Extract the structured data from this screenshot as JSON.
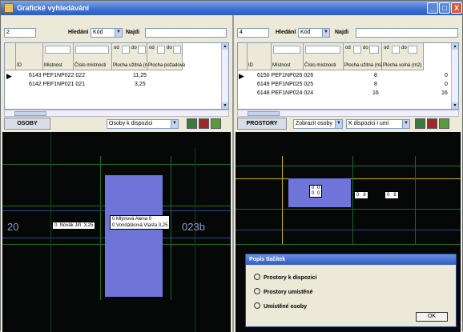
{
  "window": {
    "title": "Grafické vyhledávání",
    "min": "_",
    "max": "□",
    "close": "X"
  },
  "left": {
    "count": "2",
    "search_label": "Hledání",
    "search_by": "Kód",
    "find_label": "Najdi",
    "headers": {
      "id": "ID",
      "room": "Místnost",
      "room_no": "Číslo místnosti",
      "area_used": "Plocha užitná (m2)",
      "area_required": "Plocha požadová",
      "od": "od",
      "do": "do"
    },
    "rows": [
      {
        "id": "6143",
        "room": "PEF1NP022",
        "no": "022",
        "area": "11,25"
      },
      {
        "id": "6142",
        "room": "PEF1NP021",
        "no": "021",
        "area": "3,25"
      }
    ],
    "section_label": "OSOBY",
    "filter": "Osoby k dispozici"
  },
  "right": {
    "count": "4",
    "search_label": "Hledání",
    "search_by": "Kód",
    "find_label": "Najdi",
    "headers": {
      "id": "ID",
      "room": "Místnost",
      "room_no": "Číslo místnosti",
      "area_used": "Plocha užitná (m2)",
      "area_free": "Plocha volná (m2)",
      "od": "od",
      "do": "do"
    },
    "rows": [
      {
        "id": "6150",
        "room": "PEF1NP026",
        "no": "026",
        "used": "8",
        "free": "0"
      },
      {
        "id": "6149",
        "room": "PEF1NP025",
        "no": "025",
        "used": "8",
        "free": "0"
      },
      {
        "id": "6148",
        "room": "PEF1NP024",
        "no": "024",
        "used": "16",
        "free": "16"
      }
    ],
    "section_label": "PROSTORY",
    "show": "Zobrazit osoby",
    "filter": "K dispozici i umí"
  },
  "canvas_left": {
    "room_code_left": "20",
    "room_code_right": "023b",
    "tag1_a": "0",
    "tag1_b": "Novák Jiří",
    "tag1_c": "3,25",
    "tag2_a": "0",
    "tag2_b": "Mlýnová",
    "tag2_c": "Alena",
    "tag2_d": "0",
    "tag3_a": "0",
    "tag3_b": "Vondášková",
    "tag3_c": "Vlasta",
    "tag3_d": "3,25"
  },
  "canvas_right": {
    "tagA_1": "0",
    "tagA_2": "0",
    "tagA_3": "0",
    "tagA_4": "0",
    "tagB_1": "0",
    "tagB_2": "8",
    "tagC_1": "0",
    "tagC_2": "8"
  },
  "legend": {
    "title": "Popis tlačítek",
    "items": [
      "Prostory k dispozici",
      "Prostory umístěné",
      "Umístěné osoby"
    ],
    "ok": "OK"
  },
  "colors": {
    "title_bar": "#2c5cc0",
    "room_fill": "#6f74d8",
    "canvas_bg": "#050807"
  }
}
